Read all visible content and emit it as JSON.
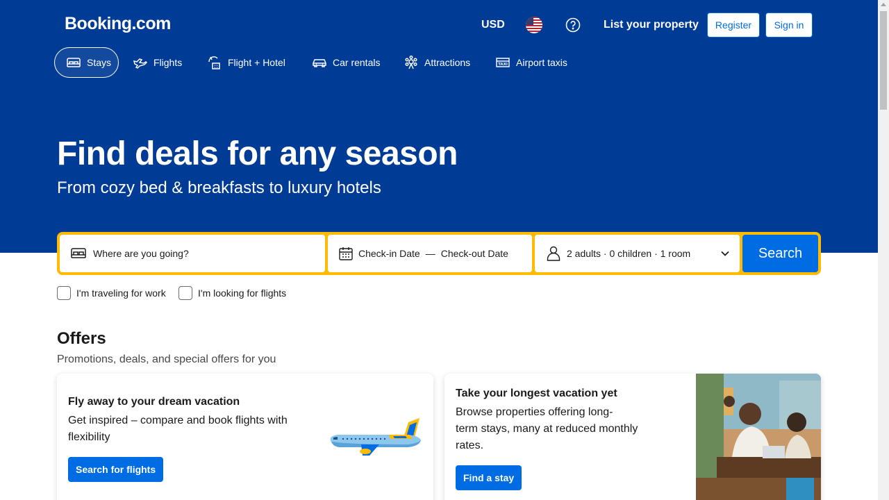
{
  "header": {
    "logo": "Booking.com",
    "currency": "USD",
    "list_property": "List your property",
    "register": "Register",
    "sign_in": "Sign in",
    "language_icon": "us-flag-icon",
    "help_icon": "help-circle-icon"
  },
  "nav": {
    "tabs": [
      {
        "label": "Stays",
        "icon": "bed-icon",
        "active": true
      },
      {
        "label": "Flights",
        "icon": "plane-icon"
      },
      {
        "label": "Flight + Hotel",
        "icon": "flight-hotel-icon"
      },
      {
        "label": "Car rentals",
        "icon": "car-icon"
      },
      {
        "label": "Attractions",
        "icon": "attractions-icon"
      },
      {
        "label": "Airport taxis",
        "icon": "taxi-icon"
      }
    ]
  },
  "hero": {
    "title": "Find deals for any season",
    "subtitle": "From cozy bed & breakfasts to luxury hotels"
  },
  "search": {
    "destination_placeholder": "Where are you going?",
    "checkin": "Check-in Date",
    "date_separator": "—",
    "checkout": "Check-out Date",
    "guests": "2 adults · 0 children · 1 room",
    "button": "Search"
  },
  "filters": {
    "work": "I'm traveling for work",
    "flights": "I'm looking for flights"
  },
  "offers": {
    "title": "Offers",
    "subtitle": "Promotions, deals, and special offers for you",
    "cards": [
      {
        "title": "Fly away to your dream vacation",
        "text_line1": "Get inspired – compare and book flights with",
        "text_line2": "flexibility",
        "button": "Search for flights"
      },
      {
        "title": "Take your longest vacation yet",
        "text_line1": "Browse properties offering long-",
        "text_line2": "term stays, many at reduced monthly",
        "text_line3": "rates.",
        "button": "Find a stay"
      }
    ]
  },
  "colors": {
    "brand_blue": "#003b95",
    "action_blue": "#006ce4",
    "search_yellow": "#febb02"
  }
}
